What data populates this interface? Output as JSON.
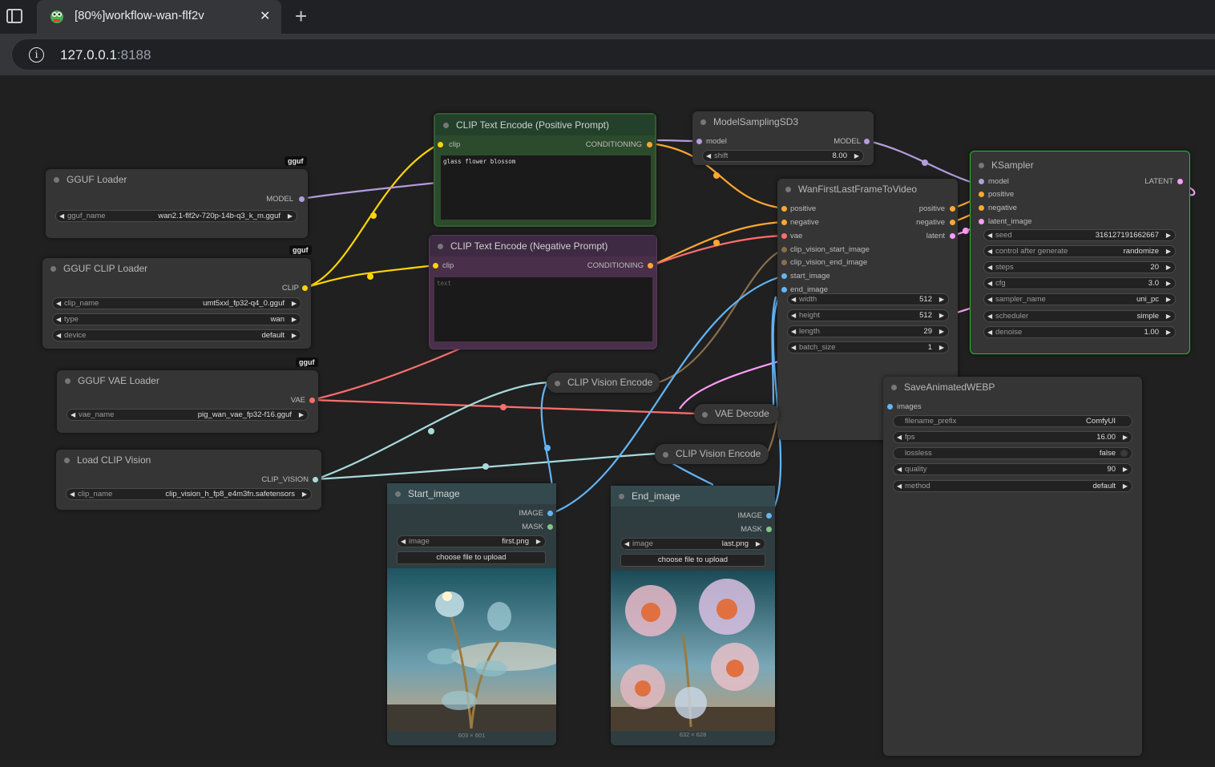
{
  "browser": {
    "tab_title": "[80%]workflow-wan-flf2v",
    "url_host": "127.0.0.1",
    "url_port": ":8188"
  },
  "nodes": {
    "gguf_loader": {
      "title": "GGUF Loader",
      "badge": "gguf",
      "out_model": "MODEL",
      "w_label": "gguf_name",
      "w_value": "wan2.1-flf2v-720p-14b-q3_k_m.gguf"
    },
    "gguf_clip_loader": {
      "title": "GGUF CLIP Loader",
      "badge": "gguf",
      "out_clip": "CLIP",
      "widgets": [
        {
          "label": "clip_name",
          "value": "umt5xxl_fp32-q4_0.gguf"
        },
        {
          "label": "type",
          "value": "wan"
        },
        {
          "label": "device",
          "value": "default"
        }
      ]
    },
    "gguf_vae_loader": {
      "title": "GGUF VAE Loader",
      "badge": "gguf",
      "out_vae": "VAE",
      "w_label": "vae_name",
      "w_value": "pig_wan_vae_fp32-f16.gguf"
    },
    "load_clip_vision": {
      "title": "Load CLIP Vision",
      "out": "CLIP_VISION",
      "w_label": "clip_name",
      "w_value": "clip_vision_h_fp8_e4m3fn.safetensors"
    },
    "clip_pos": {
      "title": "CLIP Text Encode (Positive Prompt)",
      "in_clip": "clip",
      "out": "CONDITIONING",
      "text": "glass flower blossom"
    },
    "clip_neg": {
      "title": "CLIP Text Encode (Negative Prompt)",
      "in_clip": "clip",
      "out": "CONDITIONING",
      "placeholder": "text"
    },
    "model_sampling": {
      "title": "ModelSamplingSD3",
      "in_model": "model",
      "out_model": "MODEL",
      "w_label": "shift",
      "w_value": "8.00"
    },
    "wan_flf": {
      "title": "WanFirstLastFrameToVideo",
      "inputs": [
        "positive",
        "negative",
        "vae",
        "clip_vision_start_image",
        "clip_vision_end_image",
        "start_image",
        "end_image"
      ],
      "outputs": [
        "positive",
        "negative",
        "latent"
      ],
      "widgets": [
        {
          "label": "width",
          "value": "512"
        },
        {
          "label": "height",
          "value": "512"
        },
        {
          "label": "length",
          "value": "29"
        },
        {
          "label": "batch_size",
          "value": "1"
        }
      ]
    },
    "ksampler": {
      "title": "KSampler",
      "inputs": [
        "model",
        "positive",
        "negative",
        "latent_image"
      ],
      "out": "LATENT",
      "widgets": [
        {
          "label": "seed",
          "value": "316127191662667"
        },
        {
          "label": "control after generate",
          "value": "randomize"
        },
        {
          "label": "steps",
          "value": "20"
        },
        {
          "label": "cfg",
          "value": "3.0"
        },
        {
          "label": "sampler_name",
          "value": "uni_pc"
        },
        {
          "label": "scheduler",
          "value": "simple"
        },
        {
          "label": "denoise",
          "value": "1.00"
        }
      ]
    },
    "clip_vision_encode_1": {
      "title": "CLIP Vision Encode"
    },
    "clip_vision_encode_2": {
      "title": "CLIP Vision Encode"
    },
    "vae_decode": {
      "title": "VAE Decode"
    },
    "save_webp": {
      "title": "SaveAnimatedWEBP",
      "in_images": "images",
      "widgets": [
        {
          "label": "filename_prefix",
          "value": "ComfyUI"
        },
        {
          "label": "fps",
          "value": "16.00"
        },
        {
          "label": "lossless",
          "value": "false"
        },
        {
          "label": "quality",
          "value": "90"
        },
        {
          "label": "method",
          "value": "default"
        }
      ]
    },
    "start_image": {
      "title": "Start_image",
      "out_image": "IMAGE",
      "out_mask": "MASK",
      "w_label": "image",
      "w_value": "first.png",
      "button": "choose file to upload",
      "dims": "603 × 601"
    },
    "end_image": {
      "title": "End_image",
      "out_image": "IMAGE",
      "out_mask": "MASK",
      "w_label": "image",
      "w_value": "last.png",
      "button": "choose file to upload",
      "dims": "632 × 628"
    }
  },
  "colors": {
    "model": "#b39ddb",
    "clip": "#ffd500",
    "conditioning": "#ffa931",
    "vae": "#ff6e6e",
    "clip_vision": "#a8dadc",
    "image": "#64b5f6",
    "latent": "#ff9cf9",
    "mask": "#81c784"
  }
}
